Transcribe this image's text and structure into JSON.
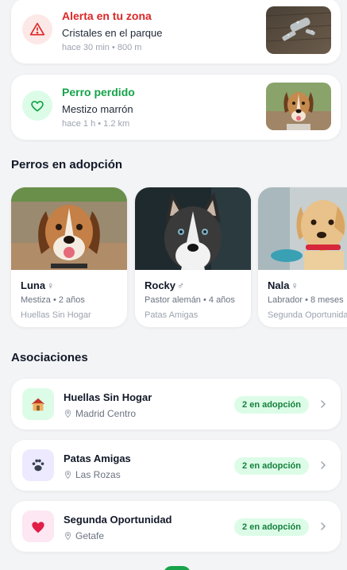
{
  "alerts": [
    {
      "title": "Alerta en tu zona",
      "subtitle": "Cristales en el parque",
      "meta": "hace 30 min • 800 m",
      "icon": "warning-triangle-icon",
      "color": "#dc2626",
      "bg": "#fde8e8"
    },
    {
      "title": "Perro perdido",
      "subtitle": "Mestizo marrón",
      "meta": "hace 1 h • 1.2 km",
      "icon": "heart-icon",
      "color": "#16a34a",
      "bg": "#dcfce7"
    }
  ],
  "adoption": {
    "title": "Perros en adopción",
    "dogs": [
      {
        "name": "Luna",
        "sex": "♀",
        "breed": "Mestiza • 2 años",
        "org": "Huellas Sin Hogar"
      },
      {
        "name": "Rocky",
        "sex": "♂",
        "breed": "Pastor alemán • 4 años",
        "org": "Patas Amigas"
      },
      {
        "name": "Nala",
        "sex": "♀",
        "breed": "Labrador • 8 meses",
        "org": "Segunda Oportunidad"
      }
    ]
  },
  "associations": {
    "title": "Asociaciones",
    "items": [
      {
        "name": "Huellas Sin Hogar",
        "location": "Madrid Centro",
        "badge": "2 en adopción",
        "icon": "house-icon",
        "bg": "#dcfce7"
      },
      {
        "name": "Patas Amigas",
        "location": "Las Rozas",
        "badge": "2 en adopción",
        "icon": "paw-icon",
        "bg": "#ede9fe"
      },
      {
        "name": "Segunda Oportunidad",
        "location": "Getafe",
        "badge": "2 en adopción",
        "icon": "heart-icon",
        "bg": "#fce7f3"
      }
    ]
  },
  "colors": {
    "accent": "#16a34a",
    "alert": "#dc2626",
    "badge_bg": "#dcfce7",
    "badge_text": "#15803d"
  }
}
